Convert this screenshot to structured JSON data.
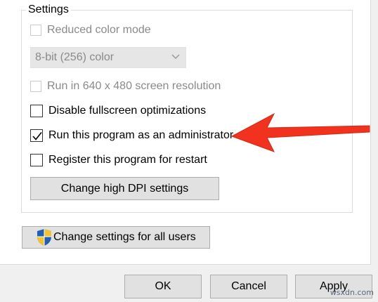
{
  "settings": {
    "title": "Settings",
    "reduced_color": {
      "label": "Reduced color mode",
      "checked": false,
      "enabled": false
    },
    "color_select": {
      "value": "8-bit (256) color",
      "enabled": false
    },
    "run_640": {
      "label": "Run in 640 x 480 screen resolution",
      "checked": false,
      "enabled": false
    },
    "disable_fullscreen": {
      "label": "Disable fullscreen optimizations",
      "checked": false,
      "enabled": true
    },
    "run_as_admin": {
      "label": "Run this program as an administrator",
      "checked": true,
      "enabled": true
    },
    "register_restart": {
      "label": "Register this program for restart",
      "checked": false,
      "enabled": true
    },
    "dpi_button": "Change high DPI settings"
  },
  "all_users_button": "Change settings for all users",
  "dialog_buttons": {
    "ok": "OK",
    "cancel": "Cancel",
    "apply": "Apply"
  },
  "annotation": {
    "arrow_color": "#f0321e"
  },
  "watermark": "wsxdn.com",
  "icons": {
    "check": "checkmark-icon",
    "chevron": "chevron-down-icon",
    "shield": "uac-shield-icon"
  }
}
